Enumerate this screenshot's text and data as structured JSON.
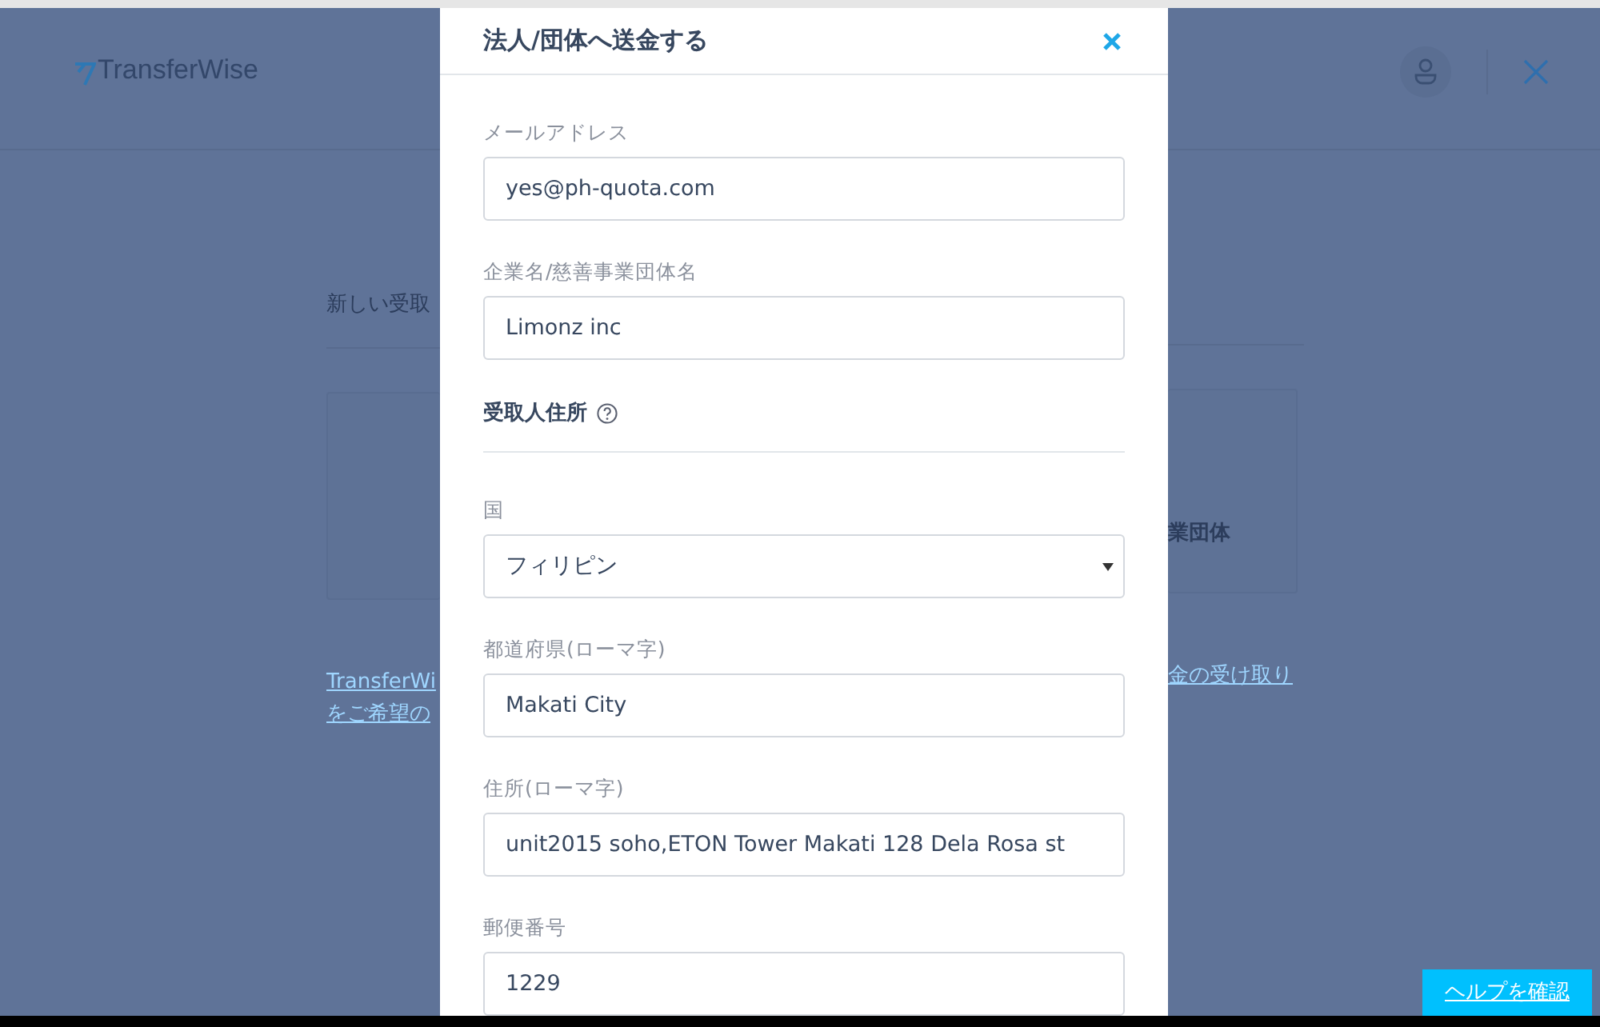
{
  "background": {
    "logo": "TransferWise",
    "section_title": "新しい受取",
    "card_right_text": "業団体",
    "link_left_lines": [
      "TransferWi",
      "をご希望の"
    ],
    "link_right": "金の受け取り"
  },
  "modal": {
    "title": "法人/団体へ送金する",
    "items": [
      {
        "kind": "text",
        "label": "メールアドレス",
        "value": "yes@ph-quota.com"
      },
      {
        "kind": "text",
        "label": "企業名/慈善事業団体名",
        "value": "Limonz inc"
      },
      {
        "kind": "section",
        "label": "受取人住所"
      },
      {
        "kind": "select",
        "label": "国",
        "value": "フィリピン"
      },
      {
        "kind": "text",
        "label": "都道府県(ローマ字)",
        "value": "Makati City"
      },
      {
        "kind": "text",
        "label": "住所(ローマ字)",
        "value": "unit2015 soho,ETON Tower Makati 128 Dela Rosa st"
      },
      {
        "kind": "text",
        "label": "郵便番号",
        "value": "1229"
      }
    ]
  },
  "help_button": "ヘルプを確認"
}
